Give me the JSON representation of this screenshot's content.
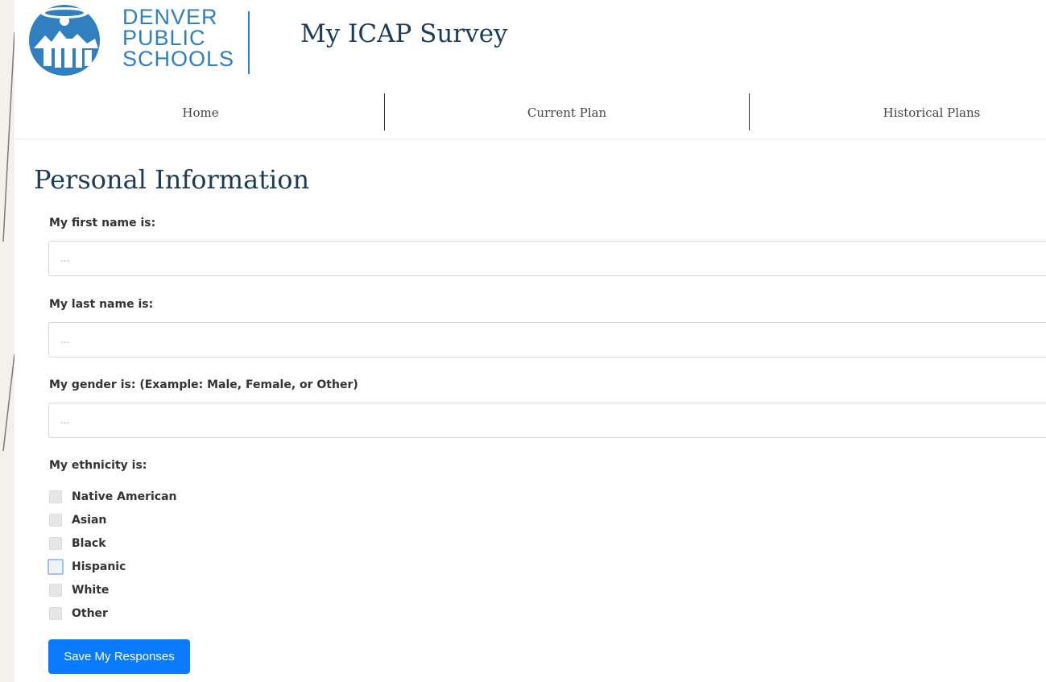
{
  "logo": {
    "line1": "DENVER",
    "line2": "PUBLIC",
    "line3": "SCHOOLS"
  },
  "app_title": "My ICAP Survey",
  "nav": {
    "items": [
      {
        "label": "Home"
      },
      {
        "label": "Current Plan"
      },
      {
        "label": "Historical Plans"
      }
    ]
  },
  "form": {
    "section_title": "Personal Information",
    "first_name": {
      "label": "My first name is:",
      "placeholder": "...",
      "value": ""
    },
    "last_name": {
      "label": "My last name is:",
      "placeholder": "...",
      "value": ""
    },
    "gender": {
      "label": "My gender is: (Example: Male, Female, or Other)",
      "placeholder": "...",
      "value": ""
    },
    "ethnicity": {
      "label": "My ethnicity is:",
      "options": [
        {
          "label": "Native American",
          "checked": false
        },
        {
          "label": "Asian",
          "checked": false
        },
        {
          "label": "Black",
          "checked": false
        },
        {
          "label": "Hispanic",
          "checked": false,
          "focused": true
        },
        {
          "label": "White",
          "checked": false
        },
        {
          "label": "Other",
          "checked": false
        }
      ]
    },
    "save_label": "Save My Responses"
  },
  "colors": {
    "brand_blue": "#2f7fc1",
    "title_navy": "#1d3a57",
    "button_blue": "#0a7bff"
  }
}
